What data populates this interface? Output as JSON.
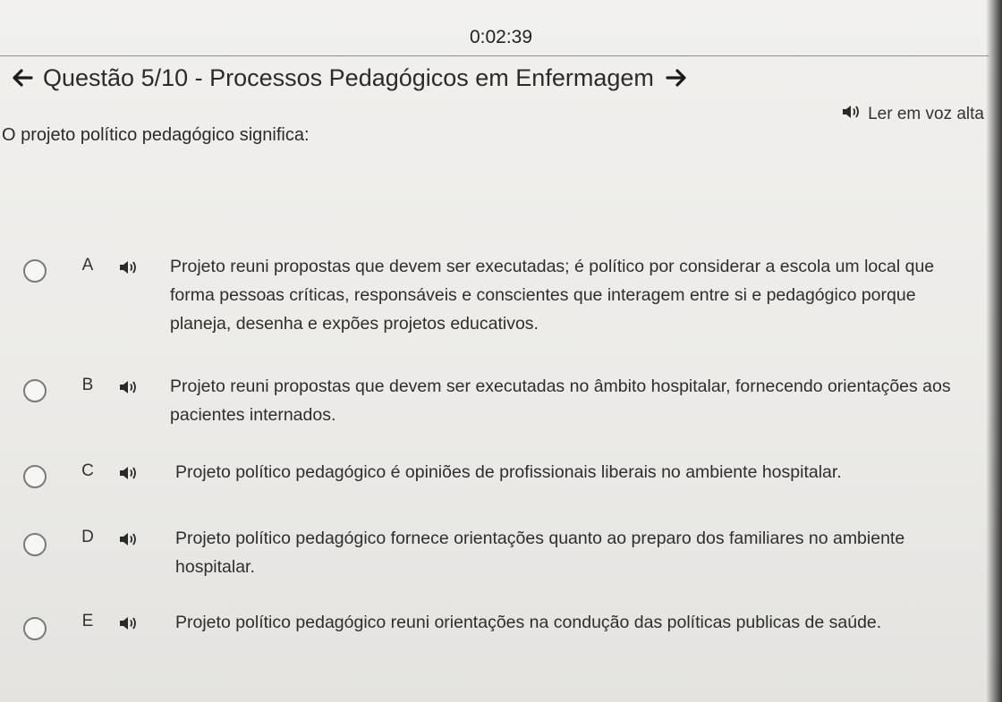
{
  "timer": "0:02:39",
  "header": {
    "title": "Questão 5/10 - Processos Pedagógicos em Enfermagem",
    "prev_icon": "arrow-left-icon",
    "next_icon": "arrow-right-icon"
  },
  "read_aloud": {
    "label": "Ler em voz alta",
    "icon": "speaker-icon"
  },
  "question": {
    "prompt": "O projeto político pedagógico significa:"
  },
  "options": [
    {
      "letter": "A",
      "text": "Projeto reuni propostas que devem ser executadas; é político por considerar a escola um local que forma pessoas críticas, responsáveis e conscientes que interagem entre si e pedagógico porque planeja, desenha e expões projetos educativos."
    },
    {
      "letter": "B",
      "text": "Projeto reuni propostas que devem ser executadas no âmbito hospitalar, fornecendo orientações aos pacientes internados."
    },
    {
      "letter": "C",
      "text": "Projeto político pedagógico é opiniões de profissionais liberais no ambiente hospitalar."
    },
    {
      "letter": "D",
      "text": "Projeto político pedagógico fornece orientações quanto ao preparo dos familiares no ambiente hospitalar."
    },
    {
      "letter": "E",
      "text": "Projeto político pedagógico reuni orientações na condução das políticas publicas de saúde."
    }
  ]
}
